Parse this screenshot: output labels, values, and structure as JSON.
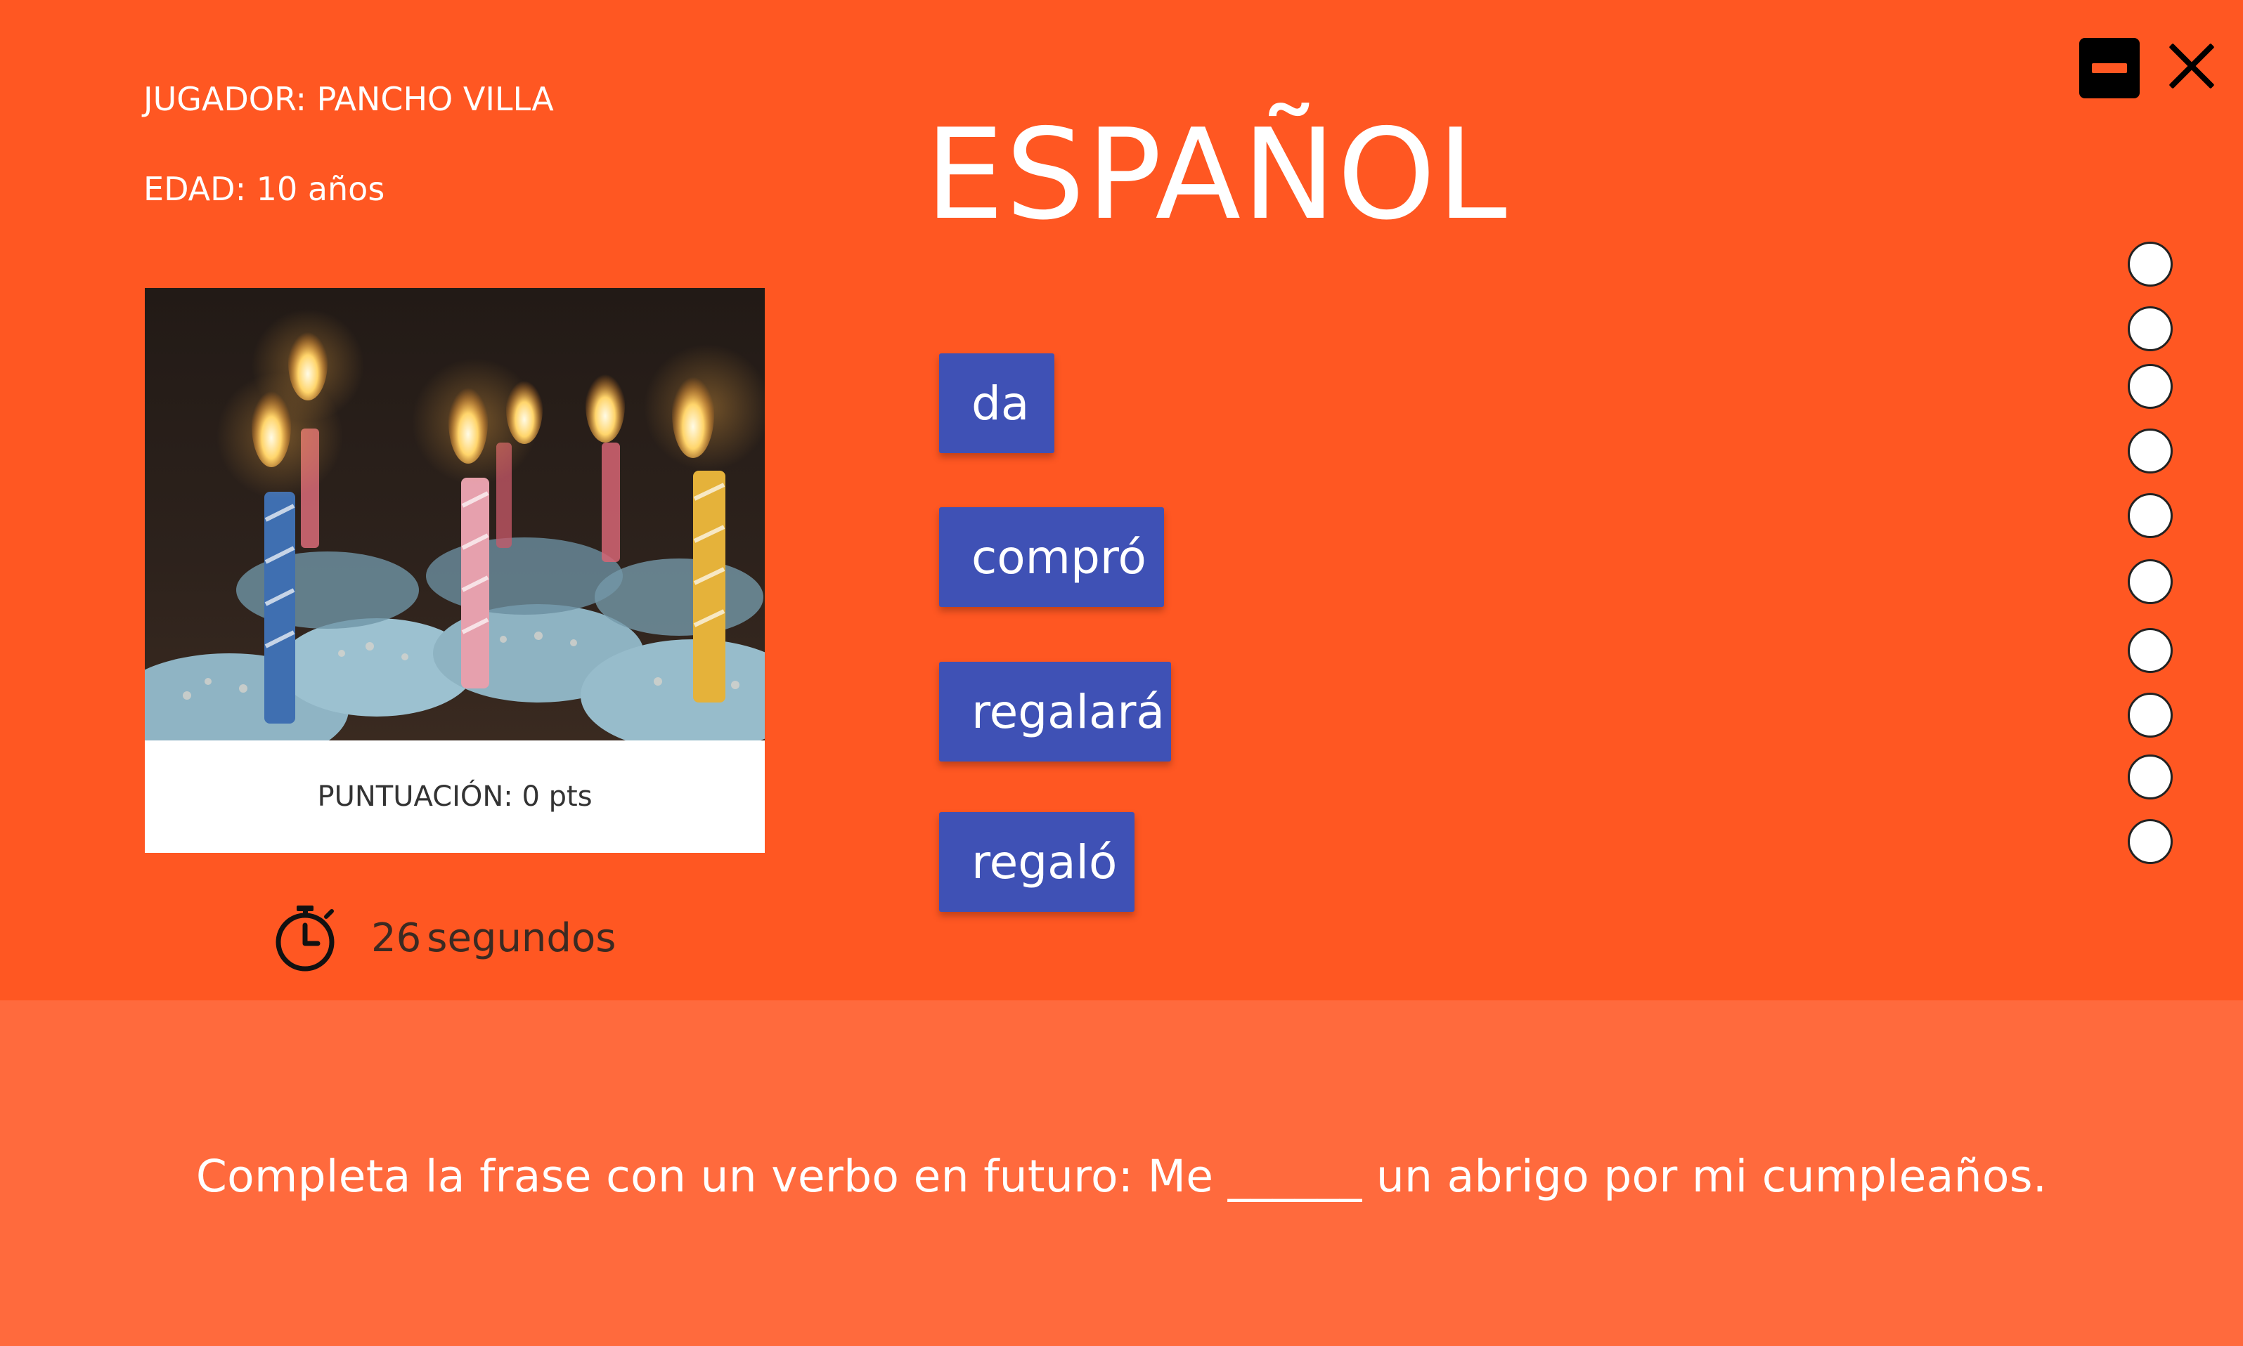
{
  "window": {
    "minimize_icon": "minimize-icon",
    "close_icon": "close-icon"
  },
  "player": {
    "name_label": "JUGADOR: PANCHO VILLA",
    "age_label": "EDAD: 10 años"
  },
  "subject": {
    "title": "ESPAÑOL"
  },
  "photo": {
    "subject": "birthday cupcakes with lit candles"
  },
  "score": {
    "label": "PUNTUACIÓN: 0 pts"
  },
  "timer": {
    "icon": "stopwatch-icon",
    "value": "26",
    "unit": "segundos"
  },
  "answer_options": [
    {
      "label": "da"
    },
    {
      "label": "compró"
    },
    {
      "label": "regalará"
    },
    {
      "label": "regaló"
    }
  ],
  "progress": {
    "total_questions": 10,
    "answered": 0
  },
  "question": {
    "text": "Completa la frase con un verbo en futuro: Me ______ un abrigo por mi cumpleaños."
  },
  "colors": {
    "background": "#FF5722",
    "bottom_panel": "#FF6A3D",
    "option_button": "#3F51B5",
    "text": "#FFFFFF"
  }
}
